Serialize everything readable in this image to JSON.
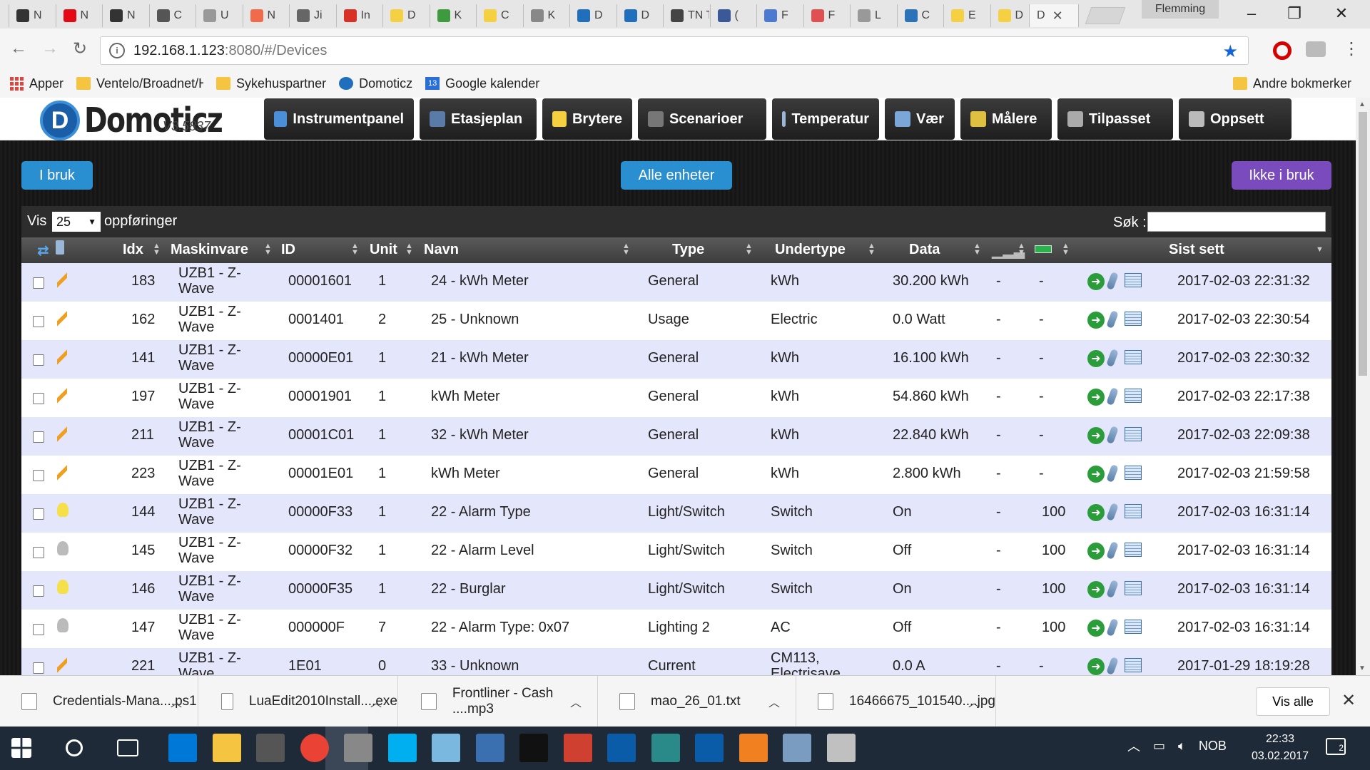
{
  "browser": {
    "tabs": [
      {
        "label": "N",
        "color": "#333333"
      },
      {
        "label": "N",
        "color": "#e50914"
      },
      {
        "label": "N",
        "color": "#333333"
      },
      {
        "label": "C",
        "color": "#555555"
      },
      {
        "label": "U",
        "color": "#999999"
      },
      {
        "label": "N",
        "color": "#ef6b4b"
      },
      {
        "label": "Ji",
        "color": "#666666"
      },
      {
        "label": "In",
        "color": "#d93025"
      },
      {
        "label": "D",
        "color": "#f5d142"
      },
      {
        "label": "K",
        "color": "#3d9b3d"
      },
      {
        "label": "C",
        "color": "#f5d142"
      },
      {
        "label": "K",
        "color": "#888888"
      },
      {
        "label": "D",
        "color": "#1f6fbd"
      },
      {
        "label": "D",
        "color": "#1f6fbd"
      },
      {
        "label": "TN T",
        "color": "#444444"
      },
      {
        "label": "(",
        "color": "#3b5998"
      },
      {
        "label": "F",
        "color": "#4a7bd0"
      },
      {
        "label": "F",
        "color": "#e05050"
      },
      {
        "label": "L",
        "color": "#999999"
      },
      {
        "label": "C",
        "color": "#2a73b8"
      },
      {
        "label": "E",
        "color": "#f5d142"
      },
      {
        "label": "D",
        "color": "#f5d142"
      }
    ],
    "active_tab": "D",
    "profile": "Flemming",
    "url_host": "192.168.1.123",
    "url_rest": ":8080/#/Devices"
  },
  "bookmarks": {
    "apps": "Apper",
    "items": [
      "Ventelo/Broadnet/Ho",
      "Sykehuspartner",
      "Domoticz",
      "Google kalender"
    ],
    "calendar_day": "13",
    "other": "Andre bokmerker"
  },
  "app": {
    "logo_text": "Domoticz",
    "version": "V3.5837",
    "nav": [
      {
        "label": "Instrumentpanel",
        "icon": "dashboard-icon",
        "color": "#4a8fd8"
      },
      {
        "label": "Etasjeplan",
        "icon": "floorplan-icon",
        "color": "#5a7aa8"
      },
      {
        "label": "Brytere",
        "icon": "lightbulb-icon",
        "color": "#f5d142"
      },
      {
        "label": "Scenarioer",
        "icon": "scenes-icon",
        "color": "#777777"
      },
      {
        "label": "Temperatur",
        "icon": "thermometer-icon",
        "color": "#9ab7d8"
      },
      {
        "label": "Vær",
        "icon": "weather-icon",
        "color": "#7aa6d8"
      },
      {
        "label": "Målere",
        "icon": "utility-icon",
        "color": "#e0c040"
      },
      {
        "label": "Tilpasset",
        "icon": "custom-icon",
        "color": "#aaaaaa"
      },
      {
        "label": "Oppsett",
        "icon": "setup-icon",
        "color": "#bbbbbb"
      }
    ],
    "filter_buttons": {
      "in_use": "I bruk",
      "all": "Alle enheter",
      "not_in_use": "Ikke i bruk"
    },
    "table": {
      "show_label": "Vis",
      "show_value": "25",
      "show_suffix": "oppføringer",
      "search_label": "Søk :",
      "columns": [
        "Idx",
        "Maskinvare",
        "ID",
        "Unit",
        "Navn",
        "Type",
        "Undertype",
        "Data",
        "Sist sett"
      ],
      "rows": [
        {
          "icon": "meter",
          "idx": "183",
          "hw1": "UZB1 - Z-",
          "hw2": "Wave",
          "id": "00001601",
          "unit": "1",
          "name": "24 - kWh Meter",
          "type": "General",
          "subtype": "kWh",
          "data": "30.200 kWh",
          "signal": "-",
          "battery": "-",
          "last": "2017-02-03 22:31:32"
        },
        {
          "icon": "meter",
          "idx": "162",
          "hw1": "UZB1 - Z-",
          "hw2": "Wave",
          "id": "0001401",
          "unit": "2",
          "name": "25 - Unknown",
          "type": "Usage",
          "subtype": "Electric",
          "data": "0.0 Watt",
          "signal": "-",
          "battery": "-",
          "last": "2017-02-03 22:30:54"
        },
        {
          "icon": "meter",
          "idx": "141",
          "hw1": "UZB1 - Z-",
          "hw2": "Wave",
          "id": "00000E01",
          "unit": "1",
          "name": "21 - kWh Meter",
          "type": "General",
          "subtype": "kWh",
          "data": "16.100 kWh",
          "signal": "-",
          "battery": "-",
          "last": "2017-02-03 22:30:32"
        },
        {
          "icon": "meter",
          "idx": "197",
          "hw1": "UZB1 - Z-",
          "hw2": "Wave",
          "id": "00001901",
          "unit": "1",
          "name": "kWh Meter",
          "type": "General",
          "subtype": "kWh",
          "data": "54.860 kWh",
          "signal": "-",
          "battery": "-",
          "last": "2017-02-03 22:17:38"
        },
        {
          "icon": "meter",
          "idx": "211",
          "hw1": "UZB1 - Z-",
          "hw2": "Wave",
          "id": "00001C01",
          "unit": "1",
          "name": "32 - kWh Meter",
          "type": "General",
          "subtype": "kWh",
          "data": "22.840 kWh",
          "signal": "-",
          "battery": "-",
          "last": "2017-02-03 22:09:38"
        },
        {
          "icon": "meter",
          "idx": "223",
          "hw1": "UZB1 - Z-",
          "hw2": "Wave",
          "id": "00001E01",
          "unit": "1",
          "name": "kWh Meter",
          "type": "General",
          "subtype": "kWh",
          "data": "2.800 kWh",
          "signal": "-",
          "battery": "-",
          "last": "2017-02-03 21:59:58"
        },
        {
          "icon": "bulb-on",
          "idx": "144",
          "hw1": "UZB1 - Z-",
          "hw2": "Wave",
          "id": "00000F33",
          "unit": "1",
          "name": "22 - Alarm Type",
          "type": "Light/Switch",
          "subtype": "Switch",
          "data": "On",
          "signal": "-",
          "battery": "100",
          "last": "2017-02-03 16:31:14"
        },
        {
          "icon": "bulb-off",
          "idx": "145",
          "hw1": "UZB1 - Z-",
          "hw2": "Wave",
          "id": "00000F32",
          "unit": "1",
          "name": "22 - Alarm Level",
          "type": "Light/Switch",
          "subtype": "Switch",
          "data": "Off",
          "signal": "-",
          "battery": "100",
          "last": "2017-02-03 16:31:14"
        },
        {
          "icon": "bulb-on",
          "idx": "146",
          "hw1": "UZB1 - Z-",
          "hw2": "Wave",
          "id": "00000F35",
          "unit": "1",
          "name": "22 - Burglar",
          "type": "Light/Switch",
          "subtype": "Switch",
          "data": "On",
          "signal": "-",
          "battery": "100",
          "last": "2017-02-03 16:31:14"
        },
        {
          "icon": "bulb-off",
          "idx": "147",
          "hw1": "UZB1 - Z-",
          "hw2": "Wave",
          "id": "000000F",
          "unit": "7",
          "name": "22 - Alarm Type: 0x07",
          "type": "Lighting 2",
          "subtype": "AC",
          "data": "Off",
          "signal": "-",
          "battery": "100",
          "last": "2017-02-03 16:31:14"
        },
        {
          "icon": "meter",
          "idx": "221",
          "hw1": "UZB1 - Z-",
          "hw2": "Wave",
          "id": "1E01",
          "unit": "0",
          "name": "33 - Unknown",
          "type": "Current",
          "subtype": "CM113,",
          "subtype2": "Electrisave",
          "data": "0.0 A",
          "signal": "-",
          "battery": "-",
          "last": "2017-01-29 18:19:28"
        }
      ]
    }
  },
  "downloads": {
    "items": [
      "Credentials-Mana....ps1",
      "LuaEdit2010Install....exe",
      "Frontliner - Cash ....mp3",
      "mao_26_01.txt",
      "16466675_101540....jpg"
    ],
    "show_all": "Vis alle"
  },
  "taskbar": {
    "language": "NOB",
    "time": "22:33",
    "date": "03.02.2017",
    "notifications": "2",
    "apps": [
      "#0078d7",
      "#f5c542",
      "#555555",
      "#ea4335",
      "#888888",
      "#00aff0",
      "#7ab8e0",
      "#3a6fb0",
      "#111111",
      "#d04030",
      "#0a5ba8",
      "#2a8a8a",
      "#0a5ba8",
      "#f08020",
      "#7a9cc0",
      "#c0c0c0"
    ]
  }
}
